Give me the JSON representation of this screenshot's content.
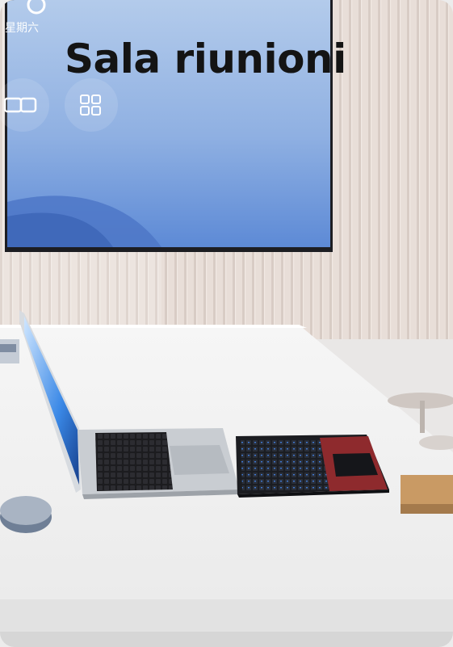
{
  "card": {
    "headline": "Sala riunioni"
  },
  "tv_screen": {
    "day_text": "星期六"
  },
  "colors": {
    "wall": "#e6dcd6",
    "tv_screen_top": "#a9c4e8",
    "tv_screen_bottom": "#4f7fd0",
    "desk": "#f2f2f2",
    "keyboard_case": "#8e2a2d",
    "laptop_body": "#c9cdd2"
  },
  "icons": [
    "clock-icon",
    "tv-window-icon",
    "tv-grid-icon"
  ]
}
